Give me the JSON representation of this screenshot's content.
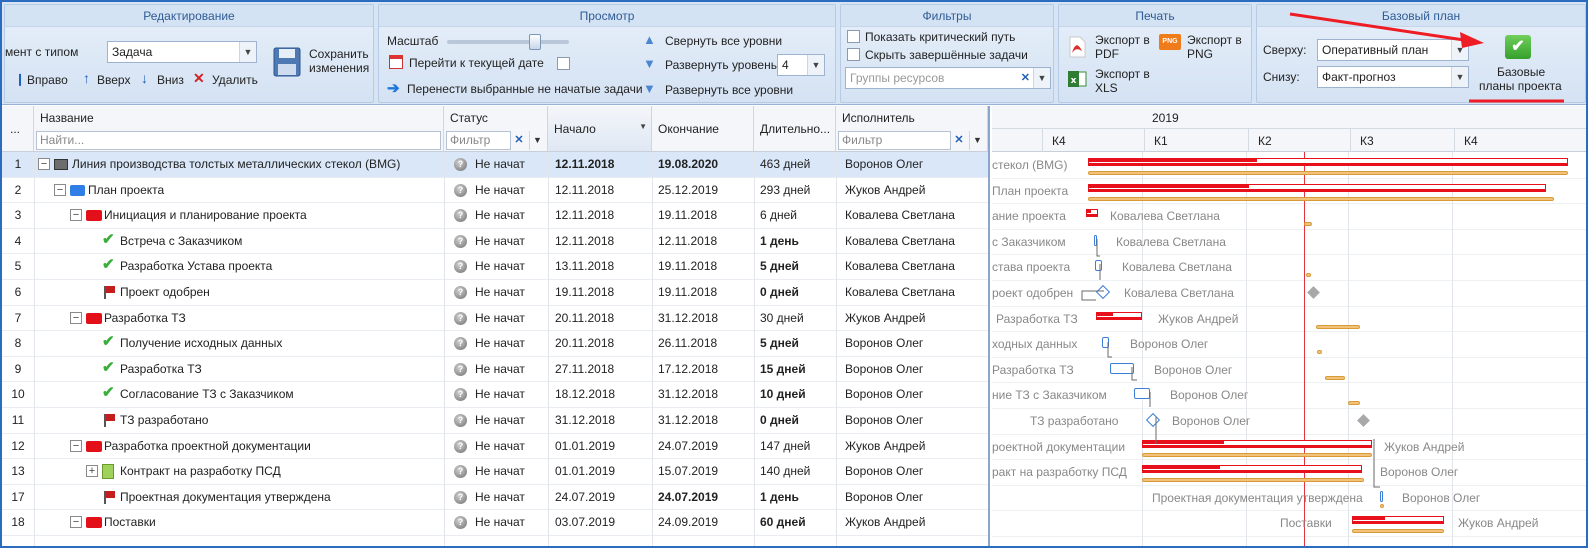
{
  "ribbon": {
    "editing": {
      "title": "Редактирование",
      "element_type_label": "мент с типом",
      "element_type_value": "Задача",
      "right": "Вправо",
      "up": "Вверх",
      "down": "Вниз",
      "delete": "Удалить",
      "save_line1": "Сохранить",
      "save_line2": "изменения"
    },
    "view": {
      "title": "Просмотр",
      "scale": "Масштаб",
      "goto_date": "Перейти к текущей дате",
      "move_tasks": "Перенести выбранные не начатые задачи",
      "collapse_all": "Свернуть все уровни",
      "expand_level": "Развернуть уровень",
      "level_value": "4",
      "expand_all": "Развернуть все уровни"
    },
    "filters": {
      "title": "Фильтры",
      "critical_path": "Показать критический путь",
      "hide_completed": "Скрыть завершённые задачи",
      "resource_groups_placeholder": "Группы ресурсов"
    },
    "print": {
      "title": "Печать",
      "pdf_line1": "Экспорт в",
      "pdf_line2": "PDF",
      "png_line1": "Экспорт в",
      "png_line2": "PNG",
      "xls_line1": "Экспорт в",
      "xls_line2": "XLS",
      "png_badge": "PNG"
    },
    "baseline": {
      "title": "Базовый план",
      "top_label": "Сверху:",
      "top_value": "Оперативный план",
      "bottom_label": "Снизу:",
      "bottom_value": "Факт-прогноз",
      "button_line1": "Базовые",
      "button_line2": "планы проекта"
    }
  },
  "columns": {
    "dots": "...",
    "name": "Название",
    "name_filter_placeholder": "Найти...",
    "status": "Статус",
    "status_filter_placeholder": "Фильтр",
    "start": "Начало",
    "end": "Окончание",
    "duration": "Длительно...",
    "assignee": "Исполнитель",
    "assignee_filter_placeholder": "Фильтр"
  },
  "rows": [
    {
      "num": "1",
      "name": "Линия производства толстых металлических стекол (BMG)",
      "status": "Не начат",
      "start": "12.11.2018",
      "end": "19.08.2020",
      "duration": "463 дней",
      "assignee": "Воронов Олег"
    },
    {
      "num": "2",
      "name": "План проекта",
      "status": "Не начат",
      "start": "12.11.2018",
      "end": "25.12.2019",
      "duration": "293 дней",
      "assignee": "Жуков Андрей"
    },
    {
      "num": "3",
      "name": "Инициация и планирование проекта",
      "status": "Не начат",
      "start": "12.11.2018",
      "end": "19.11.2018",
      "duration": "6 дней",
      "assignee": "Ковалева Светлана"
    },
    {
      "num": "4",
      "name": "Встреча с Заказчиком",
      "status": "Не начат",
      "start": "12.11.2018",
      "end": "12.11.2018",
      "duration": "1 день",
      "assignee": "Ковалева Светлана"
    },
    {
      "num": "5",
      "name": "Разработка Устава проекта",
      "status": "Не начат",
      "start": "13.11.2018",
      "end": "19.11.2018",
      "duration": "5 дней",
      "assignee": "Ковалева Светлана"
    },
    {
      "num": "6",
      "name": "Проект одобрен",
      "status": "Не начат",
      "start": "19.11.2018",
      "end": "19.11.2018",
      "duration": "0 дней",
      "assignee": "Ковалева Светлана"
    },
    {
      "num": "7",
      "name": "Разработка ТЗ",
      "status": "Не начат",
      "start": "20.11.2018",
      "end": "31.12.2018",
      "duration": "30 дней",
      "assignee": "Жуков Андрей"
    },
    {
      "num": "8",
      "name": "Получение исходных данных",
      "status": "Не начат",
      "start": "20.11.2018",
      "end": "26.11.2018",
      "duration": "5 дней",
      "assignee": "Воронов Олег"
    },
    {
      "num": "9",
      "name": "Разработка ТЗ",
      "status": "Не начат",
      "start": "27.11.2018",
      "end": "17.12.2018",
      "duration": "15 дней",
      "assignee": "Воронов Олег"
    },
    {
      "num": "10",
      "name": "Согласование ТЗ с Заказчиком",
      "status": "Не начат",
      "start": "18.12.2018",
      "end": "31.12.2018",
      "duration": "10 дней",
      "assignee": "Воронов Олег"
    },
    {
      "num": "11",
      "name": "ТЗ разработано",
      "status": "Не начат",
      "start": "31.12.2018",
      "end": "31.12.2018",
      "duration": "0 дней",
      "assignee": "Воронов Олег"
    },
    {
      "num": "12",
      "name": "Разработка проектной документации",
      "status": "Не начат",
      "start": "01.01.2019",
      "end": "24.07.2019",
      "duration": "147 дней",
      "assignee": "Жуков Андрей"
    },
    {
      "num": "13",
      "name": "Контракт на разработку ПСД",
      "status": "Не начат",
      "start": "01.01.2019",
      "end": "15.07.2019",
      "duration": "140 дней",
      "assignee": "Воронов Олег"
    },
    {
      "num": "17",
      "name": "Проектная документация утверждена",
      "status": "Не начат",
      "start": "24.07.2019",
      "end": "24.07.2019",
      "duration": "1 день",
      "assignee": "Воронов Олег"
    },
    {
      "num": "18",
      "name": "Поставки",
      "status": "Не начат",
      "start": "03.07.2019",
      "end": "24.09.2019",
      "duration": "60 дней",
      "assignee": "Жуков Андрей"
    }
  ],
  "gantt": {
    "year": "2019",
    "quarters": [
      "К4",
      "К1",
      "К2",
      "К3",
      "К4"
    ],
    "labels": [
      {
        "name": "стекол (BMG)",
        "res": ""
      },
      {
        "name": "План проекта",
        "res": ""
      },
      {
        "name": "ание проекта",
        "res": "Ковалева Светлана"
      },
      {
        "name": "с Заказчиком",
        "res": "Ковалева Светлана"
      },
      {
        "name": "става проекта",
        "res": "Ковалева Светлана"
      },
      {
        "name": "роект одобрен",
        "res": "Ковалева Светлана"
      },
      {
        "name": "Разработка ТЗ",
        "res": "Жуков Андрей"
      },
      {
        "name": "ходных данных",
        "res": "Воронов Олег"
      },
      {
        "name": "Разработка ТЗ",
        "res": "Воронов Олег"
      },
      {
        "name": "ние ТЗ с Заказчиком",
        "res": "Воронов Олег"
      },
      {
        "name": "ТЗ разработано",
        "res": "Воронов Олег"
      },
      {
        "name": "роектной документации",
        "res": "Жуков Андрей"
      },
      {
        "name": "ракт на разработку ПСД",
        "res": "Воронов Олег"
      },
      {
        "name": "Проектная документация утверждена",
        "res": "Воронов Олег"
      },
      {
        "name": "Поставки",
        "res": "Жуков Андрей"
      }
    ]
  },
  "colors": {
    "accent": "#2b6cbf",
    "summary_bar": "#e8101a",
    "baseline_bar": "#f3c27a",
    "today_line": "#e2343c",
    "check_green": "#3cae3c"
  }
}
